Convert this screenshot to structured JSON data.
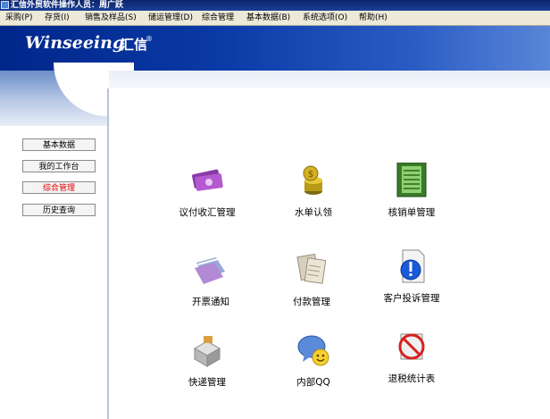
{
  "window": {
    "title": "汇信外贸软件操作人员：周广跃"
  },
  "menu": [
    "采购(P)",
    "存货(I)",
    "销售及样品(S)",
    "储运管理(D)",
    "综合管理",
    "基本数据(B)",
    "系统选项(O)",
    "帮助(H)"
  ],
  "brand": {
    "logo_text": "Winseeing",
    "logo_cn": "汇信",
    "reg_mark": "®"
  },
  "sidebar": {
    "items": [
      {
        "label": "基本数据",
        "active": false
      },
      {
        "label": "我的工作台",
        "active": false
      },
      {
        "label": "综合管理",
        "active": true
      },
      {
        "label": "历史查询",
        "active": false
      }
    ],
    "active_color": "#e00000"
  },
  "modules": [
    {
      "label": "议付收汇管理",
      "icon": "money-icon"
    },
    {
      "label": "水单认领",
      "icon": "coins-icon"
    },
    {
      "label": "核销单管理",
      "icon": "ledger-icon"
    },
    {
      "label": "开票通知",
      "icon": "folder-icon"
    },
    {
      "label": "付款管理",
      "icon": "documents-icon"
    },
    {
      "label": "客户投诉管理",
      "icon": "info-document-icon"
    },
    {
      "label": "快递管理",
      "icon": "delivery-icon"
    },
    {
      "label": "内部QQ",
      "icon": "chat-icon"
    },
    {
      "label": "退税统计表",
      "icon": "no-tax-icon"
    }
  ]
}
